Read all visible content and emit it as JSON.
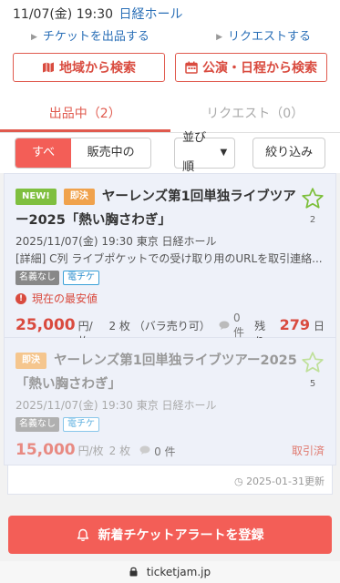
{
  "header": {
    "date": "11/07(金) 19:30",
    "venue": "日経ホール",
    "sell_link": "チケットを出品する",
    "request_link": "リクエストする",
    "search_region": "地域から検索",
    "search_schedule": "公演・日程から検索"
  },
  "tabs": [
    {
      "label": "出品中（2）",
      "active": true
    },
    {
      "label": "リクエスト（0）",
      "active": false
    }
  ],
  "filters": {
    "all": "すべて",
    "on_sale_only": "販売中のみ",
    "sort": "並び順",
    "narrow": "絞り込み"
  },
  "listings": [
    {
      "tags": [
        "NEW!",
        "即決"
      ],
      "title": "ヤーレンズ第1回単独ライブツアー2025「熱い胸さわぎ」",
      "favorites": "2",
      "datetime_place": "2025/11/07(金) 19:30 東京 日経ホール",
      "detail": "[詳細] C列 ライブポケットでの受け取り用のURLを取引連絡...",
      "badges": [
        "名義なし",
        "電チケ"
      ],
      "lowest_label": "現在の最安値",
      "price": "25,000",
      "price_unit": "円/枚",
      "quantity": "2 枚 （バラ売り可）",
      "comments": "0 件",
      "remain_label": "残り",
      "remain_days": "279",
      "remain_unit": "日"
    },
    {
      "tags": [
        "即決"
      ],
      "title": "ヤーレンズ第1回単独ライブツアー2025「熱い胸さわぎ」",
      "favorites": "5",
      "datetime_place": "2025/11/07(金) 19:30 東京 日経ホール",
      "badges": [
        "名義なし",
        "電チケ"
      ],
      "price": "15,000",
      "price_unit": "円/枚",
      "quantity": "2 枚",
      "comments": "0 件",
      "status": "取引済"
    }
  ],
  "updated": "2025-01-31更新",
  "alert_button": "新着チケットアラートを登録",
  "url": "ticketjam.jp",
  "colors": {
    "accent": "#f35e57",
    "link": "#2a6fb7",
    "card_bg": "#eef1f9"
  }
}
